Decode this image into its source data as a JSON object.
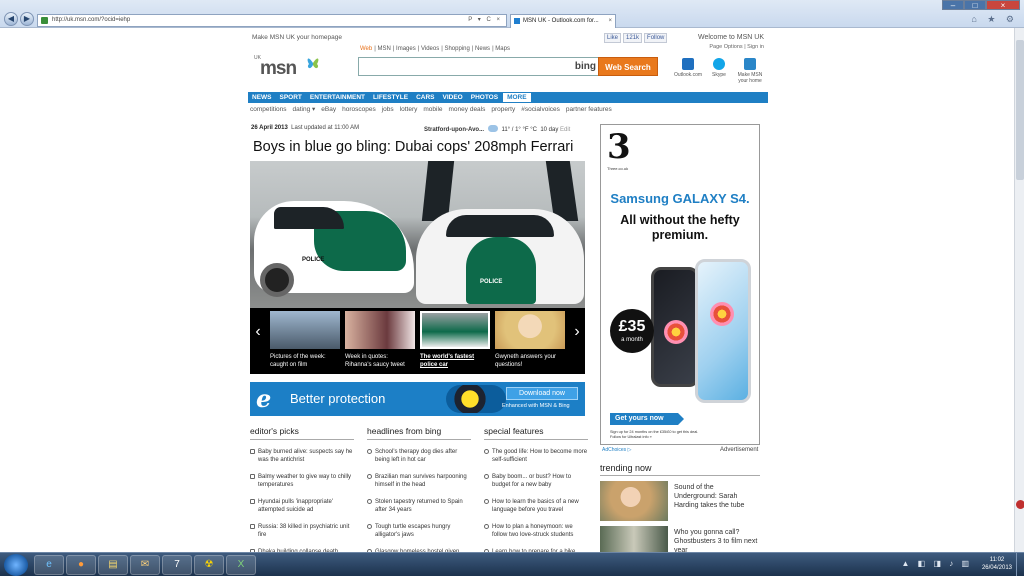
{
  "browser": {
    "url": "http://uk.msn.com/?ocid=iehp",
    "tab_title": "MSN UK - Outlook.com for...",
    "address_controls": "P ▾ C ×",
    "tools_icons": "⌂ ★ ⚙"
  },
  "header": {
    "homepage_link": "Make MSN UK your homepage",
    "social": {
      "like": "Like",
      "like_count": "121k",
      "follow": "Follow"
    },
    "welcome": "Welcome to MSN UK",
    "page_options": "Page Options",
    "sign_in": "Sign in",
    "logo_region": "UK",
    "logo": "msn",
    "search_tabs": [
      "Web",
      "MSN",
      "Images",
      "Videos",
      "Shopping",
      "News",
      "Maps"
    ],
    "search_placeholder": "",
    "bing_label": "bing",
    "search_button": "Web Search",
    "quick_links": [
      {
        "label": "Outlook.com",
        "icon": "outlook-icon"
      },
      {
        "label": "Skype",
        "icon": "skype-icon"
      },
      {
        "label": "Make MSN your home",
        "icon": "msn-home-icon"
      }
    ]
  },
  "navbar": [
    "NEWS",
    "SPORT",
    "ENTERTAINMENT",
    "LIFESTYLE",
    "CARS",
    "VIDEO",
    "PHOTOS",
    "MORE"
  ],
  "subnav": [
    "competitions",
    "dating ▾",
    "eBay",
    "horoscopes",
    "jobs",
    "lottery",
    "mobile",
    "money deals",
    "property",
    "#socialvoices",
    "partner features"
  ],
  "dateline": {
    "date": "26 April 2013",
    "updated": "Last updated at 11:00 AM"
  },
  "weather": {
    "location": "Stratford-upon-Avo...",
    "temps": "11° / 1°",
    "units": "°F °C",
    "forecast": "10 day",
    "edit": "Edit"
  },
  "hero": {
    "headline": "Boys in blue go bling: Dubai cops' 208mph Ferrari",
    "police_text": "POLICE"
  },
  "carousel": [
    {
      "caption": "Pictures of the week: caught on film"
    },
    {
      "caption": "Week in quotes: Rihanna's saucy tweet"
    },
    {
      "caption": "The world's fastest police car"
    },
    {
      "caption": "Gwyneth answers your questions!"
    }
  ],
  "ie_banner": {
    "logo": "e",
    "text": "Better protection",
    "button": "Download now",
    "sub": "Enhanced with MSN & Bing"
  },
  "columns": [
    {
      "title": "editor's picks",
      "items": [
        "Baby burned alive: suspects say he was the antichrist",
        "Balmy weather to give way to chilly temperatures",
        "Hyundai pulls 'inappropriate' attempted suicide ad",
        "Russia: 38 killed in psychiatric unit fire",
        "Dhaka building collapse death"
      ]
    },
    {
      "title": "headlines from bing",
      "items": [
        "School's therapy dog dies after being left in hot car",
        "Brazilian man survives harpooning himself in the head",
        "Stolen tapestry returned to Spain after 34 years",
        "Tough turtle escapes hungry alligator's jaws",
        "Glasgow homeless hostel given"
      ]
    },
    {
      "title": "special features",
      "items": [
        "The good life: How to become more self-sufficient",
        "Baby boom... or bust? How to budget for a new baby",
        "How to learn the basics of a new language before you travel",
        "How to plan a honeymoon: we follow two love-struck students",
        "Learn how to prepare for a bike"
      ]
    }
  ],
  "ad": {
    "brand": "3",
    "brand_url": "Three.co.uk",
    "title": "Samsung GALAXY S4.",
    "tagline": "All without the hefty premium.",
    "price": "£35",
    "price_sub": "a month",
    "cta": "Get yours now",
    "fine_print": "Sign up for 24 months on the £35/£0 to get this deal.",
    "fine_print_2": "Follow for Ultralast info »",
    "adchoices": "AdChoices ▷",
    "label": "Advertisement"
  },
  "trending": {
    "title": "trending now",
    "items": [
      "Sound of the Underground: Sarah Harding takes the tube",
      "Who you gonna call? Ghostbusters 3 to film next year"
    ]
  },
  "taskbar": {
    "time": "11:02",
    "date": "26/04/2013",
    "apps": [
      "ie-icon",
      "firefox-icon",
      "explorer-icon",
      "outlook-icon",
      "7zip-icon",
      "radiation-icon",
      "excel-icon"
    ]
  }
}
